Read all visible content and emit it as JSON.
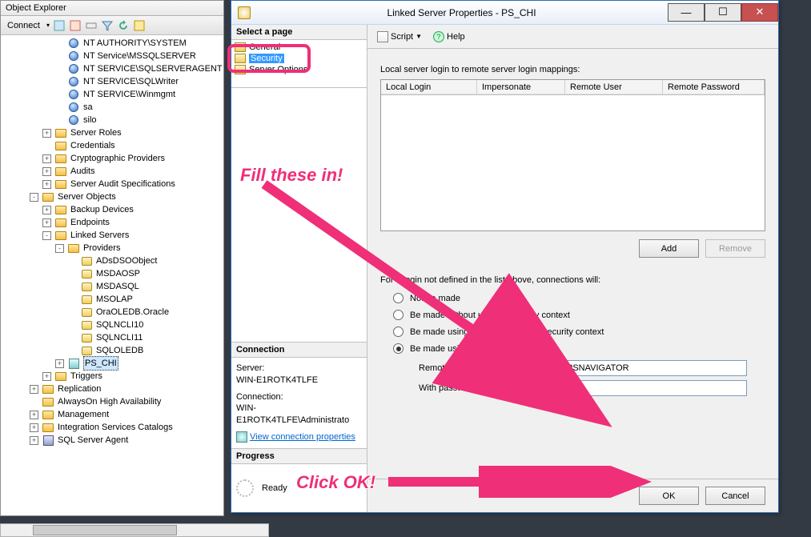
{
  "objectExplorer": {
    "title": "Object Explorer",
    "connectLabel": "Connect",
    "tree": [
      {
        "indent": 4,
        "exp": "",
        "icon": "user",
        "label": "NT AUTHORITY\\SYSTEM"
      },
      {
        "indent": 4,
        "exp": "",
        "icon": "user",
        "label": "NT Service\\MSSQLSERVER"
      },
      {
        "indent": 4,
        "exp": "",
        "icon": "user",
        "label": "NT SERVICE\\SQLSERVERAGENT"
      },
      {
        "indent": 4,
        "exp": "",
        "icon": "user",
        "label": "NT SERVICE\\SQLWriter"
      },
      {
        "indent": 4,
        "exp": "",
        "icon": "user",
        "label": "NT SERVICE\\Winmgmt"
      },
      {
        "indent": 4,
        "exp": "",
        "icon": "user",
        "label": "sa"
      },
      {
        "indent": 4,
        "exp": "",
        "icon": "user",
        "label": "silo"
      },
      {
        "indent": 3,
        "exp": "+",
        "icon": "folder",
        "label": "Server Roles"
      },
      {
        "indent": 3,
        "exp": "",
        "icon": "folder",
        "label": "Credentials"
      },
      {
        "indent": 3,
        "exp": "+",
        "icon": "folder",
        "label": "Cryptographic Providers"
      },
      {
        "indent": 3,
        "exp": "+",
        "icon": "folder",
        "label": "Audits"
      },
      {
        "indent": 3,
        "exp": "+",
        "icon": "folder",
        "label": "Server Audit Specifications"
      },
      {
        "indent": 2,
        "exp": "-",
        "icon": "folder-open",
        "label": "Server Objects"
      },
      {
        "indent": 3,
        "exp": "+",
        "icon": "folder",
        "label": "Backup Devices"
      },
      {
        "indent": 3,
        "exp": "+",
        "icon": "folder",
        "label": "Endpoints"
      },
      {
        "indent": 3,
        "exp": "-",
        "icon": "folder-open",
        "label": "Linked Servers"
      },
      {
        "indent": 4,
        "exp": "-",
        "icon": "folder-open",
        "label": "Providers"
      },
      {
        "indent": 5,
        "exp": "",
        "icon": "db",
        "label": "ADsDSOObject"
      },
      {
        "indent": 5,
        "exp": "",
        "icon": "db",
        "label": "MSDAOSP"
      },
      {
        "indent": 5,
        "exp": "",
        "icon": "db",
        "label": "MSDASQL"
      },
      {
        "indent": 5,
        "exp": "",
        "icon": "db",
        "label": "MSOLAP"
      },
      {
        "indent": 5,
        "exp": "",
        "icon": "db",
        "label": "OraOLEDB.Oracle"
      },
      {
        "indent": 5,
        "exp": "",
        "icon": "db",
        "label": "SQLNCLI10"
      },
      {
        "indent": 5,
        "exp": "",
        "icon": "db",
        "label": "SQLNCLI11"
      },
      {
        "indent": 5,
        "exp": "",
        "icon": "db",
        "label": "SQLOLEDB"
      },
      {
        "indent": 4,
        "exp": "+",
        "icon": "link",
        "label": "PS_CHI",
        "selected": true
      },
      {
        "indent": 3,
        "exp": "+",
        "icon": "folder",
        "label": "Triggers"
      },
      {
        "indent": 2,
        "exp": "+",
        "icon": "folder",
        "label": "Replication"
      },
      {
        "indent": 2,
        "exp": "",
        "icon": "folder",
        "label": "AlwaysOn High Availability"
      },
      {
        "indent": 2,
        "exp": "+",
        "icon": "folder",
        "label": "Management"
      },
      {
        "indent": 2,
        "exp": "+",
        "icon": "folder",
        "label": "Integration Services Catalogs"
      },
      {
        "indent": 2,
        "exp": "+",
        "icon": "srv",
        "label": "SQL Server Agent"
      }
    ]
  },
  "dialog": {
    "title": "Linked Server Properties - PS_CHI",
    "selectPage": "Select a page",
    "pages": [
      "General",
      "Security",
      "Server Options"
    ],
    "selectedPage": "Security",
    "scriptLabel": "Script",
    "helpLabel": "Help",
    "connection": {
      "header": "Connection",
      "serverLabel": "Server:",
      "serverValue": "WIN-E1ROTK4TLFE",
      "connLabel": "Connection:",
      "connValue": "WIN-E1ROTK4TLFE\\Administrato",
      "viewLink": "View connection properties"
    },
    "progress": {
      "header": "Progress",
      "status": "Ready"
    },
    "mappingsLabel": "Local server login to remote server login mappings:",
    "gridHeaders": [
      "Local Login",
      "Impersonate",
      "Remote User",
      "Remote Password"
    ],
    "addLabel": "Add",
    "removeLabel": "Remove",
    "notDefinedLabel": "For a login not defined in the list above, connections will:",
    "radios": {
      "r1": "Not be made",
      "r2": "Be made without using a security context",
      "r3": "Be made using the login's current security context",
      "r4": "Be made using this security context:"
    },
    "remoteLoginLabel": "Remote login:",
    "remoteLoginValue": "PSNAVIGATOR",
    "withPasswordLabel": "With password:",
    "withPasswordValue": "••••••",
    "okLabel": "OK",
    "cancelLabel": "Cancel"
  },
  "annotations": {
    "fill": "Fill these in!",
    "clickOk": "Click OK!"
  }
}
